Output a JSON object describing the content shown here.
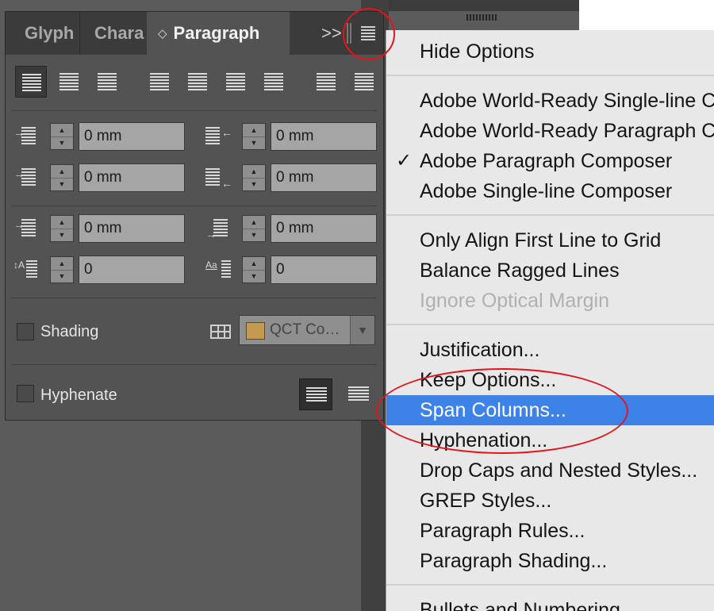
{
  "tabs": {
    "glyph": "Glyph",
    "character": "Chara",
    "paragraph": "Paragraph",
    "paragraph_icon": "◇",
    "overflow_glyph": ">>"
  },
  "fields": {
    "left_indent": "0 mm",
    "right_indent": "0 mm",
    "first_line_indent": "0 mm",
    "last_line_indent": "0 mm",
    "space_before": "0 mm",
    "space_after": "0 mm",
    "drop_cap_lines": "0",
    "drop_cap_chars": "0"
  },
  "shading": {
    "label": "Shading",
    "color_name": "QCT Co…",
    "swatch_color": "#c49a52"
  },
  "hyphenate": {
    "label": "Hyphenate"
  },
  "menu": {
    "check_mark": "✓",
    "items": [
      "Hide Options",
      "Adobe World-Ready Single-line Composer",
      "Adobe World-Ready Paragraph Composer",
      "Adobe Paragraph Composer",
      "Adobe Single-line Composer",
      "Only Align First Line to Grid",
      "Balance Ragged Lines",
      "Ignore Optical Margin",
      "Justification...",
      "Keep Options...",
      "Span Columns...",
      "Hyphenation...",
      "Drop Caps and Nested Styles...",
      "GREP Styles...",
      "Paragraph Rules...",
      "Paragraph Shading...",
      "Bullets and Numbering..."
    ]
  },
  "colors": {
    "highlight": "#3d82e6",
    "annotation_red": "#e3141b",
    "panel_bg": "#535353"
  }
}
